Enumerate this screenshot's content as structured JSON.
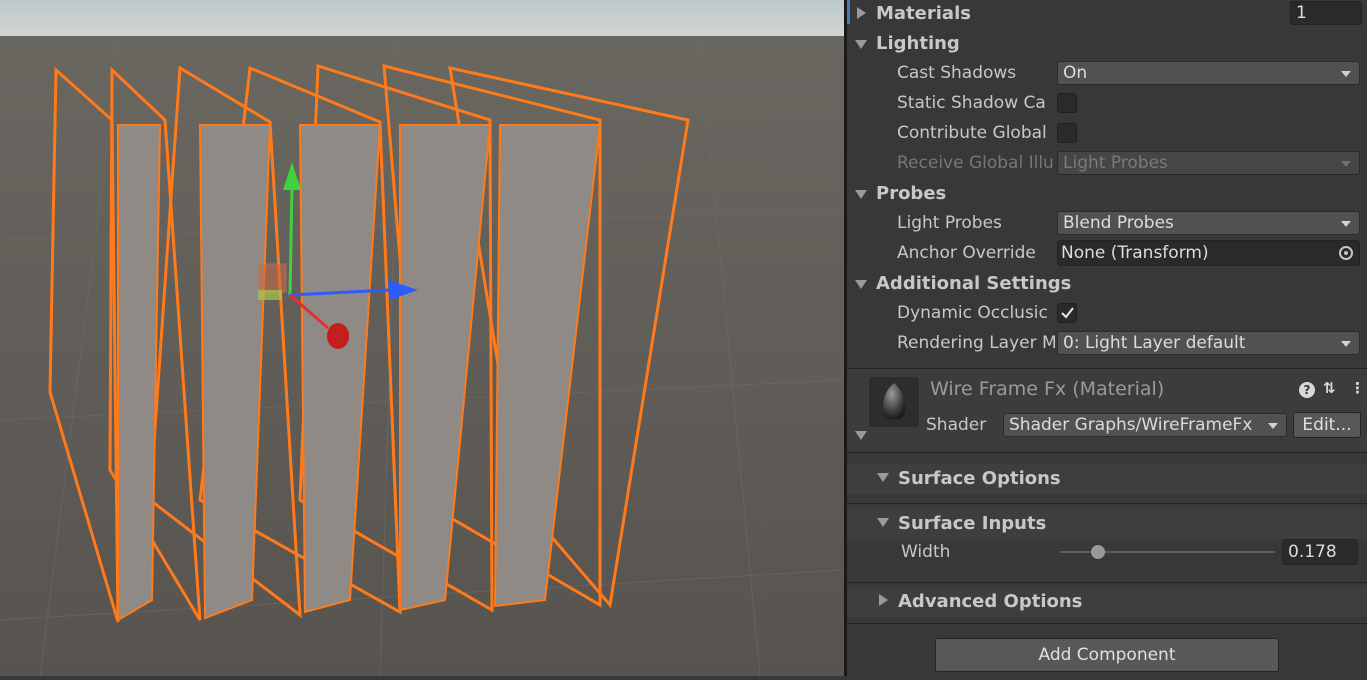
{
  "inspector": {
    "materials": {
      "label": "Materials",
      "count": "1"
    },
    "lighting": {
      "header": "Lighting",
      "cast_shadows": {
        "label": "Cast Shadows",
        "value": "On"
      },
      "static_shadow_caster": {
        "label": "Static Shadow Ca"
      },
      "contribute_gi": {
        "label": "Contribute Global"
      },
      "receive_gi": {
        "label": "Receive Global Illu",
        "value": "Light Probes"
      }
    },
    "probes": {
      "header": "Probes",
      "light_probes": {
        "label": "Light Probes",
        "value": "Blend Probes"
      },
      "anchor_override": {
        "label": "Anchor Override",
        "value": "None (Transform)"
      }
    },
    "additional": {
      "header": "Additional Settings",
      "dynamic_occlusion": {
        "label": "Dynamic Occlusic",
        "checked": true
      },
      "rendering_layer": {
        "label": "Rendering Layer M",
        "value": "0: Light Layer default"
      }
    },
    "material": {
      "title": "Wire Frame Fx (Material)",
      "shader_label": "Shader",
      "shader_value": "Shader Graphs/WireFrameFx",
      "edit_label": "Edit...",
      "help_glyph": "?",
      "settings_glyph": "⇅",
      "more_glyph": "⋮"
    },
    "surface_options": {
      "header": "Surface Options"
    },
    "surface_inputs": {
      "header": "Surface Inputs",
      "width": {
        "label": "Width",
        "value": "0.178",
        "fraction": 0.178
      }
    },
    "advanced_options": {
      "header": "Advanced Options"
    },
    "add_component": "Add Component"
  },
  "colors": {
    "panel": "#383838",
    "outline": "#ff7a1a",
    "slab": "#8f8a86",
    "ground": "#5b5752",
    "sky": "#c9d3d6",
    "gizmo_x": "#e53030",
    "gizmo_y": "#3ed23e",
    "gizmo_z": "#2e5bff"
  }
}
